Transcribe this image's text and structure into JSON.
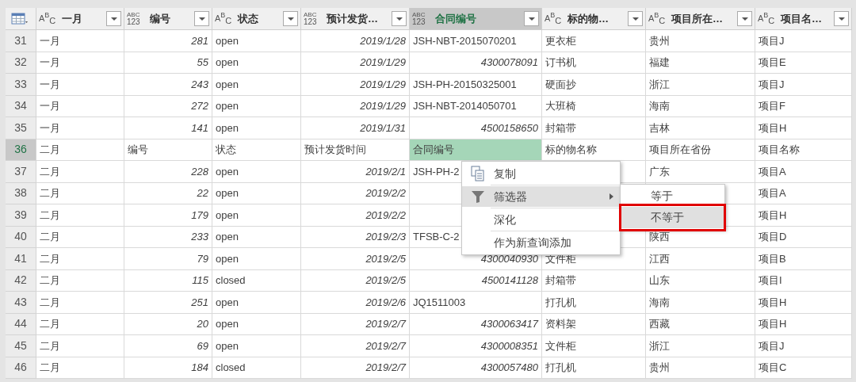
{
  "columns": [
    {
      "title": "一月",
      "type_icon": [
        "A",
        "B",
        "C"
      ],
      "selected": false
    },
    {
      "title": "编号",
      "type_icon": [
        "ABC",
        "123"
      ],
      "selected": false
    },
    {
      "title": "状态",
      "type_icon": [
        "A",
        "B",
        "C"
      ],
      "selected": false
    },
    {
      "title": "预计发货…",
      "type_icon": [
        "ABC",
        "123"
      ],
      "selected": false
    },
    {
      "title": "合同编号",
      "type_icon": [
        "ABC",
        "123"
      ],
      "selected": true
    },
    {
      "title": "标的物…",
      "type_icon": [
        "A",
        "B",
        "C"
      ],
      "selected": false
    },
    {
      "title": "项目所在…",
      "type_icon": [
        "A",
        "B",
        "C"
      ],
      "selected": false
    },
    {
      "title": "项目名…",
      "type_icon": [
        "A",
        "B",
        "C"
      ],
      "selected": false
    }
  ],
  "rows": [
    {
      "number": "31",
      "selected": false,
      "cells": [
        {
          "text": "一月",
          "kind": "text"
        },
        {
          "text": "281",
          "kind": "number"
        },
        {
          "text": "open",
          "kind": "text"
        },
        {
          "text": "2019/1/28",
          "kind": "number"
        },
        {
          "text": "JSH-NBT-2015070201",
          "kind": "text"
        },
        {
          "text": "更衣柜",
          "kind": "text"
        },
        {
          "text": "贵州",
          "kind": "text"
        },
        {
          "text": "项目J",
          "kind": "text"
        }
      ]
    },
    {
      "number": "32",
      "selected": false,
      "cells": [
        {
          "text": "一月",
          "kind": "text"
        },
        {
          "text": "55",
          "kind": "number"
        },
        {
          "text": "open",
          "kind": "text"
        },
        {
          "text": "2019/1/29",
          "kind": "number"
        },
        {
          "text": "4300078091",
          "kind": "number"
        },
        {
          "text": "订书机",
          "kind": "text"
        },
        {
          "text": "福建",
          "kind": "text"
        },
        {
          "text": "项目E",
          "kind": "text"
        }
      ]
    },
    {
      "number": "33",
      "selected": false,
      "cells": [
        {
          "text": "一月",
          "kind": "text"
        },
        {
          "text": "243",
          "kind": "number"
        },
        {
          "text": "open",
          "kind": "text"
        },
        {
          "text": "2019/1/29",
          "kind": "number"
        },
        {
          "text": "JSH-PH-20150325001",
          "kind": "text"
        },
        {
          "text": "硬面抄",
          "kind": "text"
        },
        {
          "text": "浙江",
          "kind": "text"
        },
        {
          "text": "项目J",
          "kind": "text"
        }
      ]
    },
    {
      "number": "34",
      "selected": false,
      "cells": [
        {
          "text": "一月",
          "kind": "text"
        },
        {
          "text": "272",
          "kind": "number"
        },
        {
          "text": "open",
          "kind": "text"
        },
        {
          "text": "2019/1/29",
          "kind": "number"
        },
        {
          "text": "JSH-NBT-2014050701",
          "kind": "text"
        },
        {
          "text": "大班椅",
          "kind": "text"
        },
        {
          "text": "海南",
          "kind": "text"
        },
        {
          "text": "项目F",
          "kind": "text"
        }
      ]
    },
    {
      "number": "35",
      "selected": false,
      "cells": [
        {
          "text": "一月",
          "kind": "text"
        },
        {
          "text": "141",
          "kind": "number"
        },
        {
          "text": "open",
          "kind": "text"
        },
        {
          "text": "2019/1/31",
          "kind": "number"
        },
        {
          "text": "4500158650",
          "kind": "number"
        },
        {
          "text": "封箱带",
          "kind": "text"
        },
        {
          "text": "吉林",
          "kind": "text"
        },
        {
          "text": "项目H",
          "kind": "text"
        }
      ]
    },
    {
      "number": "36",
      "selected": true,
      "cells": [
        {
          "text": "二月",
          "kind": "text"
        },
        {
          "text": "编号",
          "kind": "text"
        },
        {
          "text": "状态",
          "kind": "text"
        },
        {
          "text": "预计发货时间",
          "kind": "text"
        },
        {
          "text": "合同编号",
          "kind": "text"
        },
        {
          "text": "标的物名称",
          "kind": "text"
        },
        {
          "text": "项目所在省份",
          "kind": "text"
        },
        {
          "text": "项目名称",
          "kind": "text"
        }
      ]
    },
    {
      "number": "37",
      "selected": false,
      "cells": [
        {
          "text": "二月",
          "kind": "text"
        },
        {
          "text": "228",
          "kind": "number"
        },
        {
          "text": "open",
          "kind": "text"
        },
        {
          "text": "2019/2/1",
          "kind": "number"
        },
        {
          "text": "JSH-PH-2",
          "kind": "text"
        },
        null,
        {
          "text": "广东",
          "kind": "text"
        },
        {
          "text": "项目A",
          "kind": "text"
        }
      ]
    },
    {
      "number": "38",
      "selected": false,
      "cells": [
        {
          "text": "二月",
          "kind": "text"
        },
        {
          "text": "22",
          "kind": "number"
        },
        {
          "text": "open",
          "kind": "text"
        },
        {
          "text": "2019/2/2",
          "kind": "number"
        },
        null,
        null,
        null,
        {
          "text": "项目A",
          "kind": "text"
        }
      ]
    },
    {
      "number": "39",
      "selected": false,
      "cells": [
        {
          "text": "二月",
          "kind": "text"
        },
        {
          "text": "179",
          "kind": "number"
        },
        {
          "text": "open",
          "kind": "text"
        },
        {
          "text": "2019/2/2",
          "kind": "number"
        },
        null,
        null,
        null,
        {
          "text": "项目H",
          "kind": "text"
        }
      ]
    },
    {
      "number": "40",
      "selected": false,
      "cells": [
        {
          "text": "二月",
          "kind": "text"
        },
        {
          "text": "233",
          "kind": "number"
        },
        {
          "text": "open",
          "kind": "text"
        },
        {
          "text": "2019/2/3",
          "kind": "number"
        },
        {
          "text": "TFSB-C-2",
          "kind": "text"
        },
        null,
        {
          "text": "陕西",
          "kind": "text"
        },
        {
          "text": "项目D",
          "kind": "text"
        }
      ]
    },
    {
      "number": "41",
      "selected": false,
      "cells": [
        {
          "text": "二月",
          "kind": "text"
        },
        {
          "text": "79",
          "kind": "number"
        },
        {
          "text": "open",
          "kind": "text"
        },
        {
          "text": "2019/2/5",
          "kind": "number"
        },
        {
          "text": "4300040930",
          "kind": "number"
        },
        {
          "text": "文件柜",
          "kind": "text"
        },
        {
          "text": "江西",
          "kind": "text"
        },
        {
          "text": "项目B",
          "kind": "text"
        }
      ]
    },
    {
      "number": "42",
      "selected": false,
      "cells": [
        {
          "text": "二月",
          "kind": "text"
        },
        {
          "text": "115",
          "kind": "number"
        },
        {
          "text": "closed",
          "kind": "text"
        },
        {
          "text": "2019/2/5",
          "kind": "number"
        },
        {
          "text": "4500141128",
          "kind": "number"
        },
        {
          "text": "封箱带",
          "kind": "text"
        },
        {
          "text": "山东",
          "kind": "text"
        },
        {
          "text": "项目I",
          "kind": "text"
        }
      ]
    },
    {
      "number": "43",
      "selected": false,
      "cells": [
        {
          "text": "二月",
          "kind": "text"
        },
        {
          "text": "251",
          "kind": "number"
        },
        {
          "text": "open",
          "kind": "text"
        },
        {
          "text": "2019/2/6",
          "kind": "number"
        },
        {
          "text": "JQ1511003",
          "kind": "text"
        },
        {
          "text": "打孔机",
          "kind": "text"
        },
        {
          "text": "海南",
          "kind": "text"
        },
        {
          "text": "项目H",
          "kind": "text"
        }
      ]
    },
    {
      "number": "44",
      "selected": false,
      "cells": [
        {
          "text": "二月",
          "kind": "text"
        },
        {
          "text": "20",
          "kind": "number"
        },
        {
          "text": "open",
          "kind": "text"
        },
        {
          "text": "2019/2/7",
          "kind": "number"
        },
        {
          "text": "4300063417",
          "kind": "number"
        },
        {
          "text": "资料架",
          "kind": "text"
        },
        {
          "text": "西藏",
          "kind": "text"
        },
        {
          "text": "项目H",
          "kind": "text"
        }
      ]
    },
    {
      "number": "45",
      "selected": false,
      "cells": [
        {
          "text": "二月",
          "kind": "text"
        },
        {
          "text": "69",
          "kind": "number"
        },
        {
          "text": "open",
          "kind": "text"
        },
        {
          "text": "2019/2/7",
          "kind": "number"
        },
        {
          "text": "4300008351",
          "kind": "number"
        },
        {
          "text": "文件柜",
          "kind": "text"
        },
        {
          "text": "浙江",
          "kind": "text"
        },
        {
          "text": "项目J",
          "kind": "text"
        }
      ]
    },
    {
      "number": "46",
      "selected": false,
      "cells": [
        {
          "text": "二月",
          "kind": "text"
        },
        {
          "text": "184",
          "kind": "number"
        },
        {
          "text": "closed",
          "kind": "text"
        },
        {
          "text": "2019/2/7",
          "kind": "number"
        },
        {
          "text": "4300057480",
          "kind": "number"
        },
        {
          "text": "打孔机",
          "kind": "text"
        },
        {
          "text": "贵州",
          "kind": "text"
        },
        {
          "text": "项目C",
          "kind": "text"
        }
      ]
    }
  ],
  "context_menu": {
    "items": [
      {
        "label": "复制",
        "kind": "copy",
        "selected": false,
        "has_submenu": false
      },
      {
        "label": "筛选器",
        "kind": "filter",
        "selected": true,
        "has_submenu": true
      },
      {
        "label": "深化",
        "kind": "plain",
        "selected": false,
        "has_submenu": false
      },
      {
        "label": "作为新查询添加",
        "kind": "plain",
        "selected": false,
        "has_submenu": false
      }
    ],
    "submenu": [
      {
        "label": "等于",
        "selected": false,
        "outlined": false
      },
      {
        "label": "不等于",
        "selected": true,
        "outlined": true
      }
    ]
  }
}
